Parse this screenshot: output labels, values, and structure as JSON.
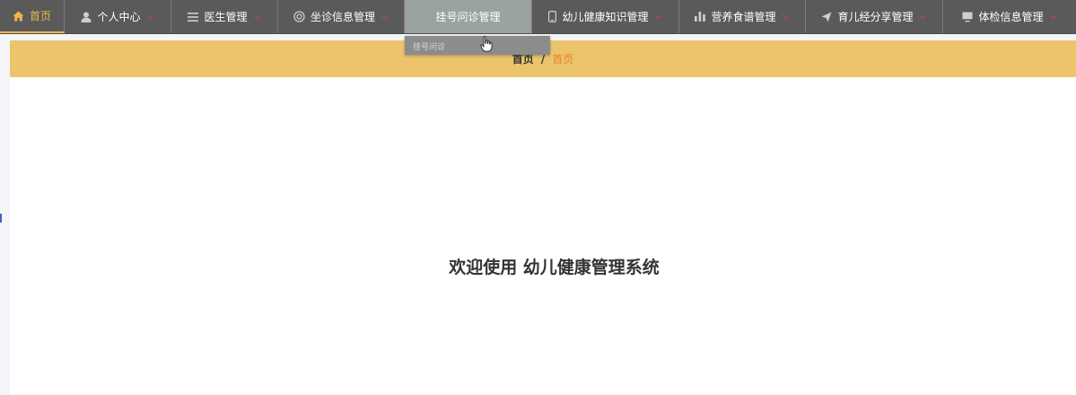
{
  "nav": {
    "items": [
      {
        "label": "首页",
        "icon": "home-icon",
        "has_dropdown": false
      },
      {
        "label": "个人中心",
        "icon": "user-icon",
        "has_dropdown": true
      },
      {
        "label": "医生管理",
        "icon": "list-icon",
        "has_dropdown": true
      },
      {
        "label": "坐诊信息管理",
        "icon": "circle-icon",
        "has_dropdown": true
      },
      {
        "label": "挂号问诊管理",
        "icon": "",
        "has_dropdown": false
      },
      {
        "label": "幼儿健康知识管理",
        "icon": "mobile-icon",
        "has_dropdown": true
      },
      {
        "label": "营养食谱管理",
        "icon": "bar-chart-icon",
        "has_dropdown": true
      },
      {
        "label": "育儿经分享管理",
        "icon": "send-icon",
        "has_dropdown": true
      },
      {
        "label": "体检信息管理",
        "icon": "monitor-icon",
        "has_dropdown": true
      }
    ],
    "active_index": 4
  },
  "dropdown": {
    "items": [
      "挂号问诊"
    ]
  },
  "breadcrumb": {
    "home": "首页",
    "separator": "/",
    "current": "首页"
  },
  "main": {
    "welcome": "欢迎使用 幼儿健康管理系统"
  },
  "colors": {
    "nav_bg": "#5a5a5a",
    "accent": "#f0b54a",
    "breadcrumb_bg": "#ebc46b",
    "breadcrumb_current": "#e8842c",
    "active_item_bg": "#9aa39f"
  }
}
